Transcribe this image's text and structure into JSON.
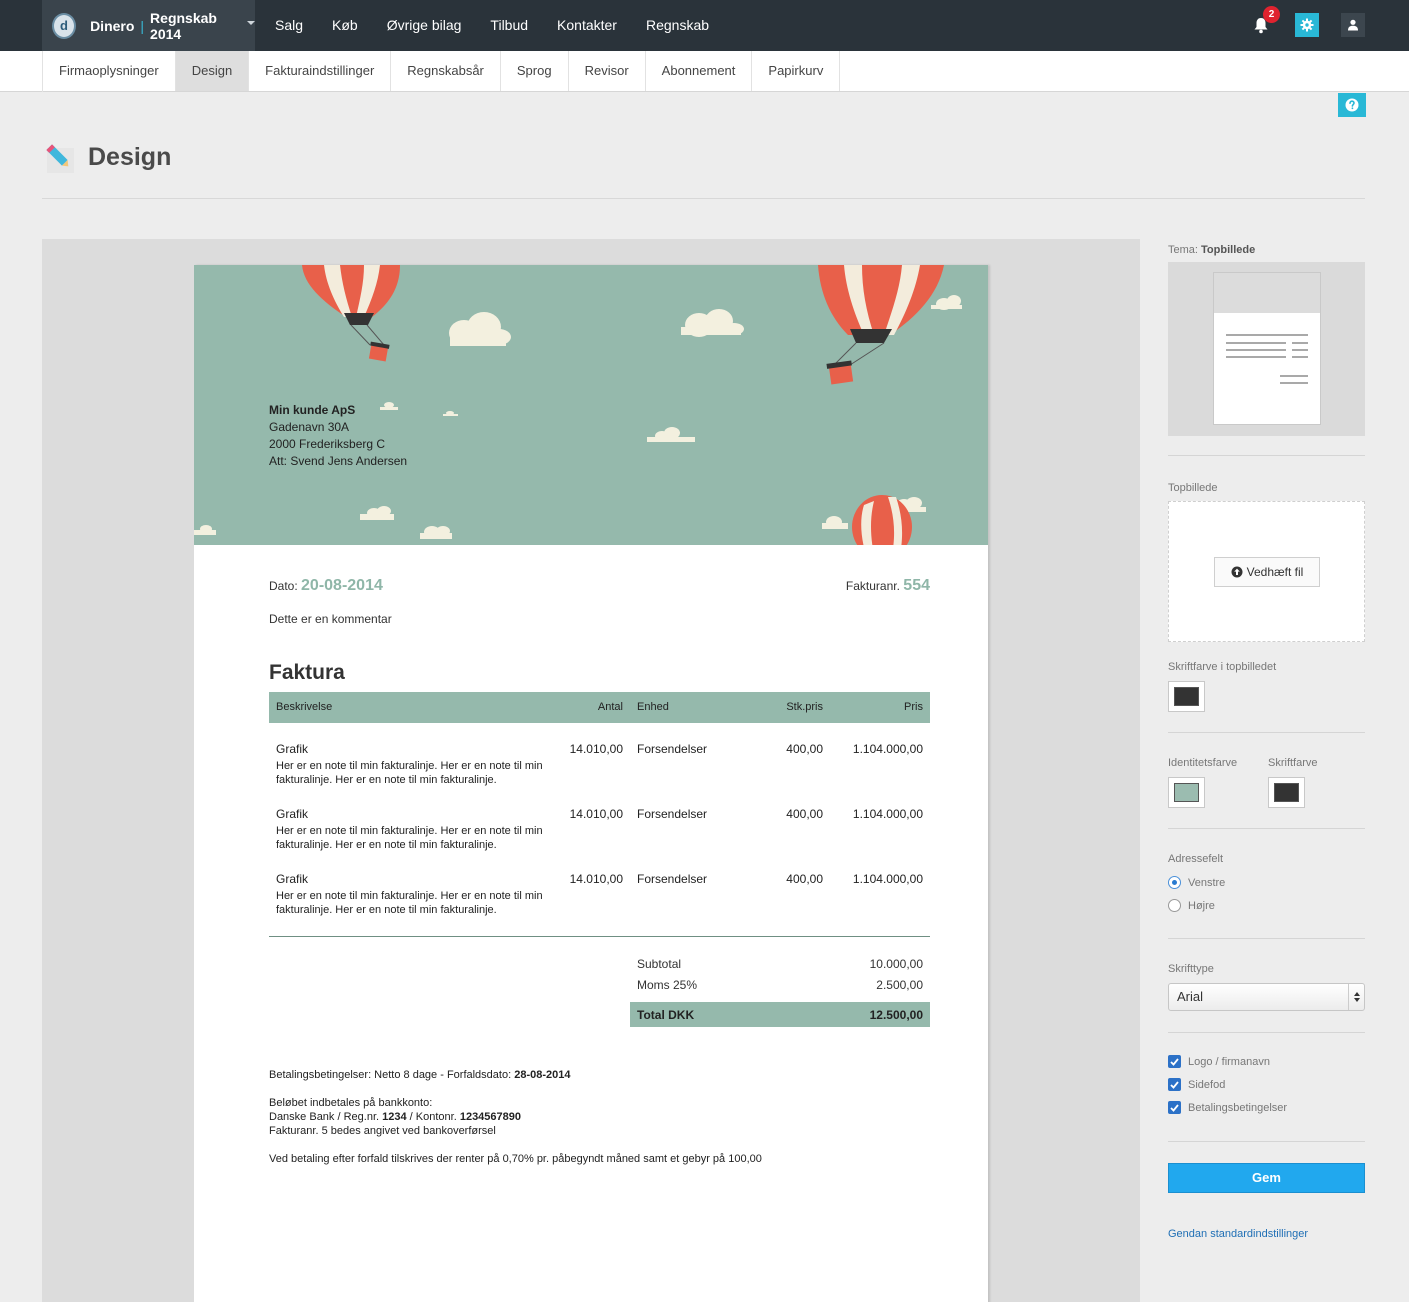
{
  "header": {
    "brand": "Dinero",
    "brand_separator": "|",
    "brand_year": "Regnskab 2014",
    "nav": [
      "Salg",
      "Køb",
      "Øvrige bilag",
      "Tilbud",
      "Kontakter",
      "Regnskab"
    ],
    "notification_count": "2"
  },
  "subnav": {
    "tabs": [
      "Firmaoplysninger",
      "Design",
      "Fakturaindstillinger",
      "Regnskabsår",
      "Sprog",
      "Revisor",
      "Abonnement",
      "Papirkurv"
    ],
    "active": "Design"
  },
  "page": {
    "title": "Design"
  },
  "invoice": {
    "customer": {
      "name": "Min kunde ApS",
      "street": "Gadenavn 30A",
      "city": "2000 Frederiksberg C",
      "att": "Att: Svend Jens Andersen"
    },
    "date_label": "Dato:",
    "date": "20-08-2014",
    "number_label": "Fakturanr.",
    "number": "554",
    "comment": "Dette er en kommentar",
    "title": "Faktura",
    "columns": {
      "description": "Beskrivelse",
      "quantity": "Antal",
      "unit": "Enhed",
      "unit_price": "Stk.pris",
      "price": "Pris"
    },
    "lines": [
      {
        "description": "Grafik",
        "note": "Her er en note til min fakturalinje. Her er en note til min fakturalinje. Her er en note til min fakturalinje.",
        "quantity": "14.010,00",
        "unit": "Forsendelser",
        "unit_price": "400,00",
        "price": "1.104.000,00"
      },
      {
        "description": "Grafik",
        "note": "Her er en note til min fakturalinje. Her er en note til min fakturalinje. Her er en note til min fakturalinje.",
        "quantity": "14.010,00",
        "unit": "Forsendelser",
        "unit_price": "400,00",
        "price": "1.104.000,00"
      },
      {
        "description": "Grafik",
        "note": "Her er en note til min fakturalinje. Her er en note til min fakturalinje. Her er en note til min fakturalinje.",
        "quantity": "14.010,00",
        "unit": "Forsendelser",
        "unit_price": "400,00",
        "price": "1.104.000,00"
      }
    ],
    "subtotal_label": "Subtotal",
    "subtotal": "10.000,00",
    "vat_label": "Moms 25%",
    "vat": "2.500,00",
    "total_label": "Total DKK",
    "total": "12.500,00",
    "terms_prefix": "Betalingsbetingelser: Netto 8 dage - Forfaldsdato:",
    "due_date": "28-08-2014",
    "bank_intro": "Beløbet indbetales på bankkonto:",
    "bank_prefix": "Danske Bank / Reg.nr.",
    "reg_nr": "1234",
    "account_prefix": "/ Kontonr.",
    "account_nr": "1234567890",
    "bank_note": "Fakturanr. 5 bedes angivet ved bankoverførsel",
    "late_fee": "Ved betaling efter forfald tilskrives der renter på 0,70% pr. påbegyndt måned samt et gebyr på 100,00"
  },
  "sidebar": {
    "theme_label": "Tema:",
    "theme_value": "Topbillede",
    "topimage_label": "Topbillede",
    "upload_button": "Vedhæft fil",
    "topimage_font_color_label": "Skriftfarve i topbilledet",
    "topimage_font_color": "#333333",
    "identity_color_label": "Identitetsfarve",
    "identity_color": "#9bbcb0",
    "font_color_label": "Skriftfarve",
    "font_color": "#333333",
    "address_label": "Adressefelt",
    "address_options": [
      "Venstre",
      "Højre"
    ],
    "address_selected": "Venstre",
    "font_label": "Skrifttype",
    "font_value": "Arial",
    "checkboxes": [
      "Logo / firmanavn",
      "Sidefod",
      "Betalingsbetingelser"
    ],
    "save_button": "Gem",
    "reset_link": "Gendan standardindstillinger"
  },
  "colors": {
    "topbar": "#2a333a",
    "accent": "#29b8d6",
    "banner": "#95b9ac",
    "save": "#21a8ee"
  }
}
